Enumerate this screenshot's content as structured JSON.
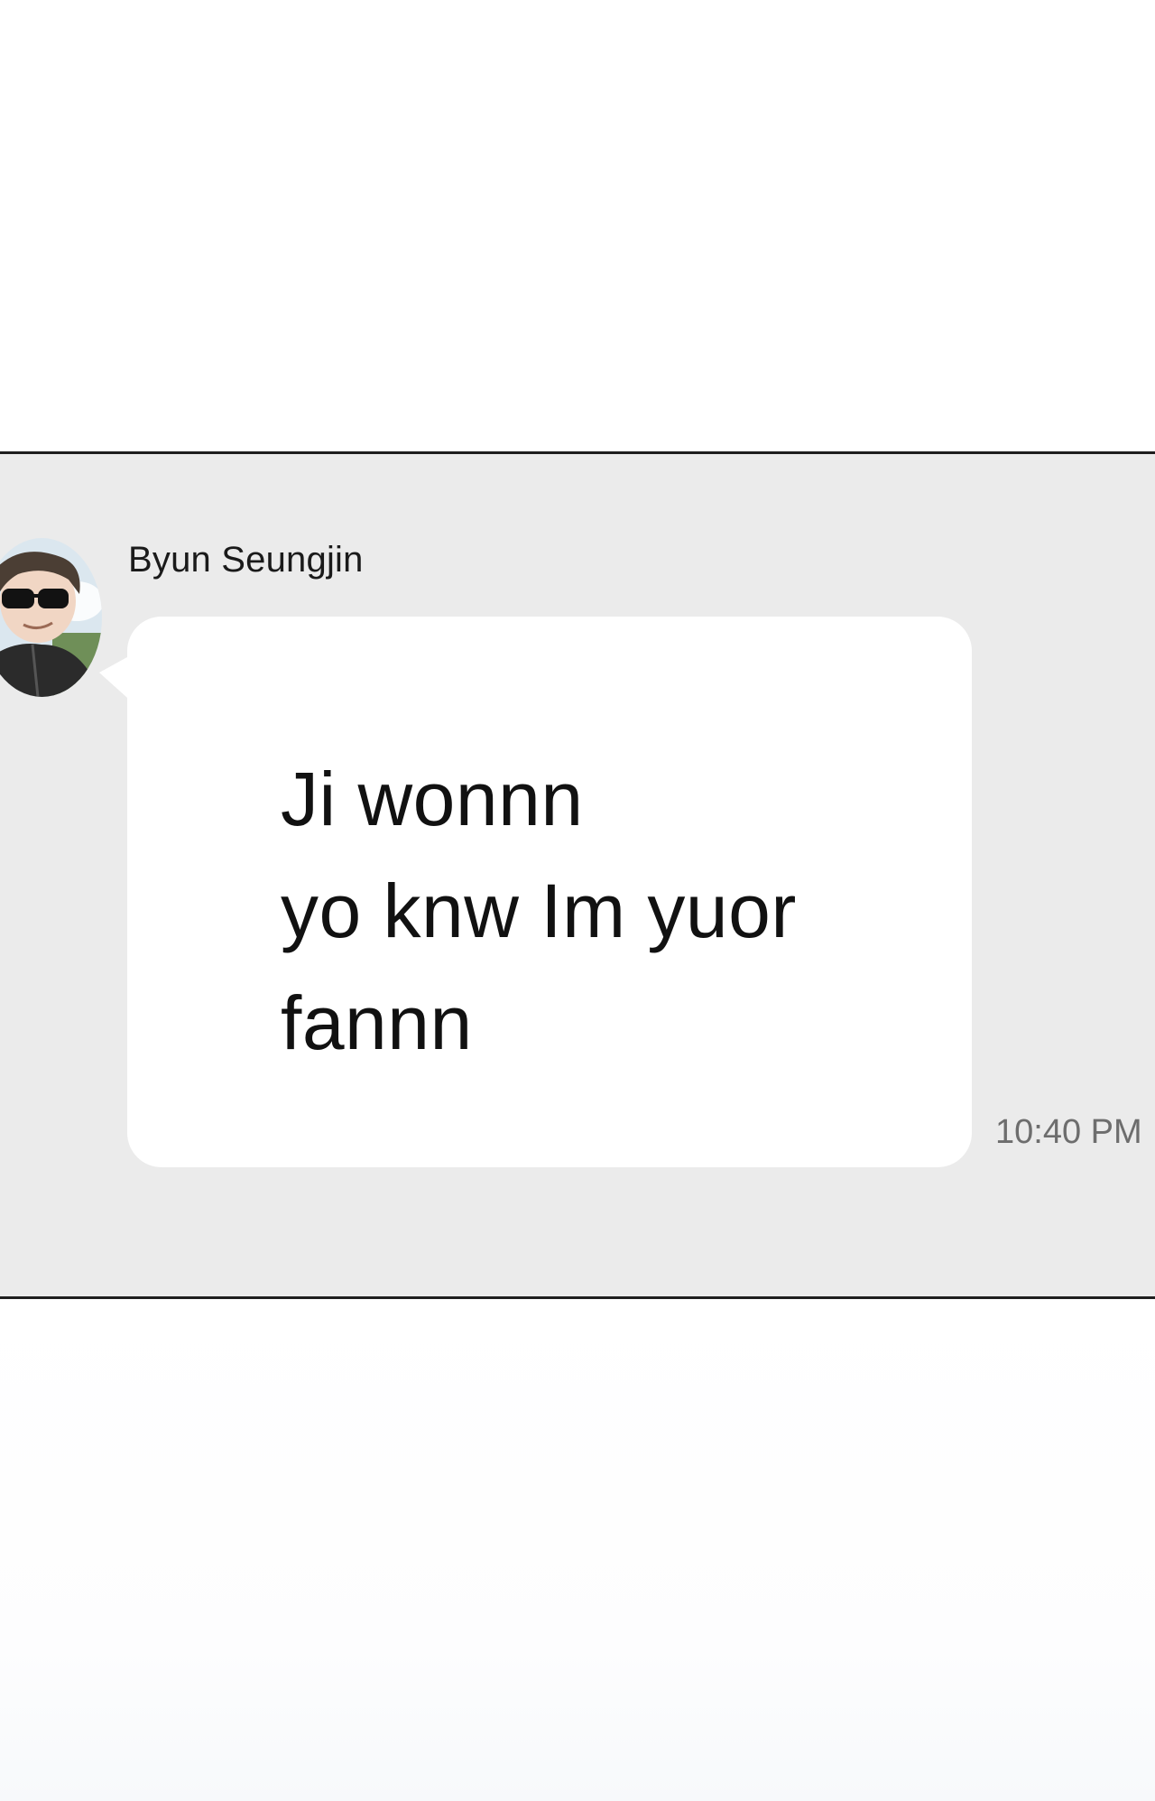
{
  "conversation": {
    "sender_name": "Byun Seungjin",
    "message": "Ji wonnn\nyo knw Im yuor\nfannn",
    "timestamp": "10:40 PM"
  },
  "colors": {
    "panel_background": "#ebebeb",
    "bubble_background": "#ffffff",
    "panel_border": "#1e1e1e",
    "timestamp_color": "#6d6d6d"
  },
  "icons": {
    "avatar": "profile-avatar-icon"
  }
}
